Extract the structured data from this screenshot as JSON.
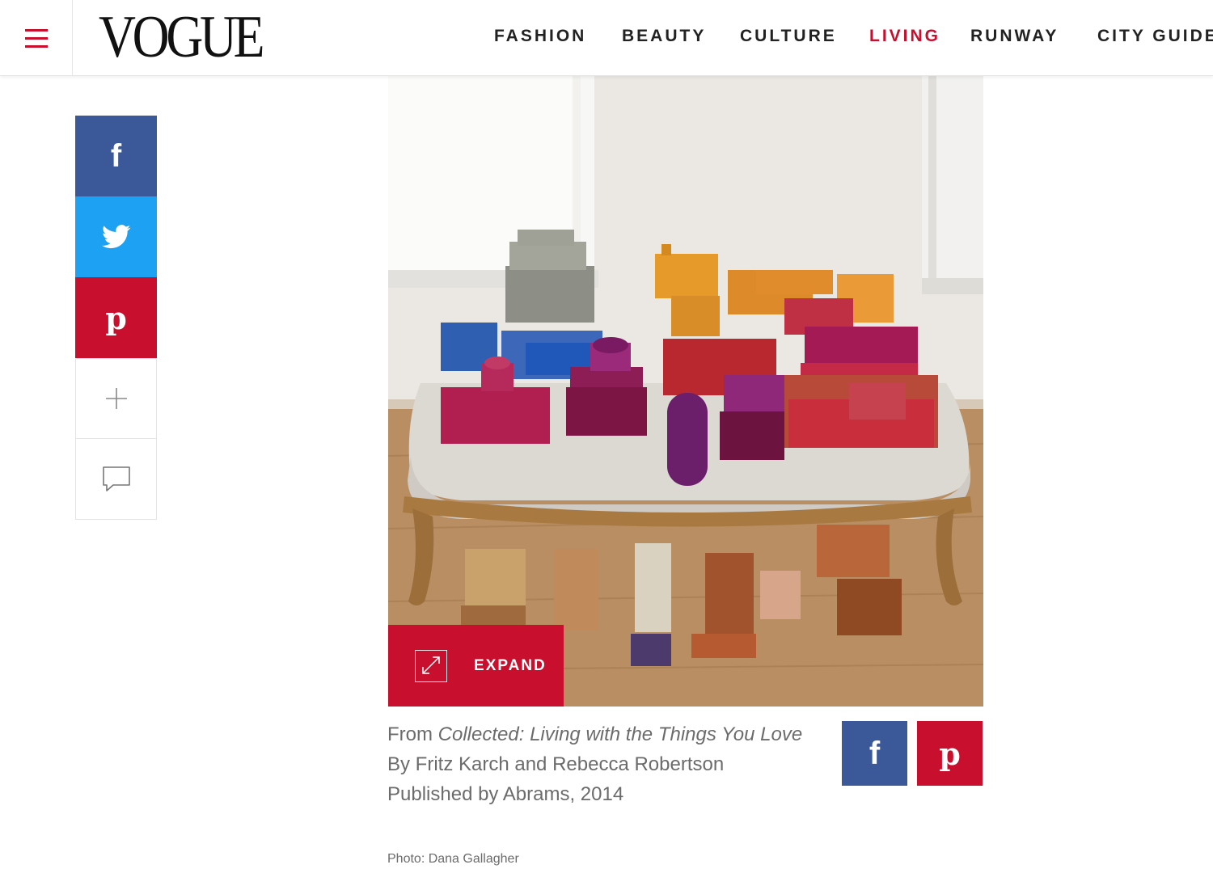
{
  "header": {
    "logo": "VOGUE",
    "nav": [
      {
        "label": "FASHION",
        "active": false
      },
      {
        "label": "BEAUTY",
        "active": false
      },
      {
        "label": "CULTURE",
        "active": false
      },
      {
        "label": "LIVING",
        "active": true
      },
      {
        "label": "RUNWAY",
        "active": false
      },
      {
        "label": "CITY GUIDE",
        "active": false
      }
    ]
  },
  "share_rail": {
    "facebook_glyph": "f",
    "pinterest_glyph": "p",
    "more_glyph": "+",
    "icons": [
      "facebook-icon",
      "twitter-icon",
      "pinterest-icon",
      "plus-icon",
      "comment-icon"
    ]
  },
  "image": {
    "expand_label": "EXPAND"
  },
  "caption": {
    "prefix": "From ",
    "book_title": "Collected: Living with the Things You Love",
    "authors": "By Fritz Karch and Rebecca Robertson",
    "publisher": "Published by Abrams, 2014",
    "photo_credit": "Photo: Dana Gallagher"
  },
  "caption_share": {
    "facebook_glyph": "f",
    "pinterest_glyph": "p"
  },
  "colors": {
    "brand_red": "#c8102e",
    "facebook": "#3b5998",
    "twitter": "#1da1f2",
    "pinterest": "#c8102e",
    "caption_text": "#6b6b6b"
  }
}
